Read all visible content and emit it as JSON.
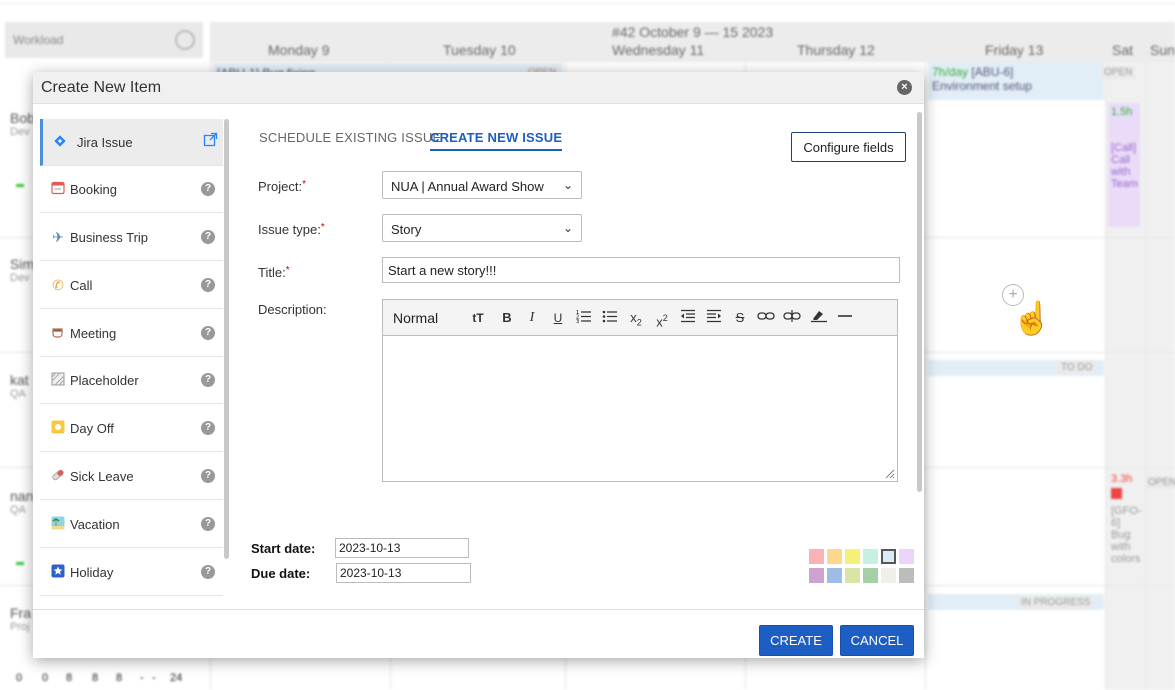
{
  "background": {
    "week_label": "#42 October 9 — 15 2023",
    "workload_label": "Workload",
    "days": [
      "Monday 9",
      "Tuesday 10",
      "Wednesday 11",
      "Thursday 12",
      "Friday 13",
      "Sat",
      "Sun"
    ],
    "users": [
      {
        "name": "Bob",
        "role": "Dev"
      },
      {
        "name": "Sim",
        "role": "Dev"
      },
      {
        "name": "kat",
        "role": "QA"
      },
      {
        "name": "nan",
        "role": "QA"
      },
      {
        "name": "Fra",
        "role": "Proj"
      }
    ],
    "events": {
      "monday_top": "[ABU-1] Bug fixing",
      "open_1": "OPEN",
      "friday_rate": "7h/day",
      "friday_issue": "[ABU-6]",
      "friday_title": "Environment setup",
      "open_2": "OPEN",
      "sat_purple_rate": "1.5h",
      "sat_purple_title": "[Call] Call with Team",
      "todo": "TO DO",
      "sat_red_rate": "3.3h",
      "sat_red_title": "[GFO-6] Bug with colors",
      "in_progress": "IN PROGRESS"
    },
    "bottom_values": [
      "0",
      "0",
      "8",
      "8",
      "8",
      "-",
      "-",
      "24"
    ]
  },
  "dialog": {
    "title": "Create New Item",
    "sidebar": [
      {
        "label": "Jira Issue",
        "icon": "jira-diamond-icon",
        "active": true
      },
      {
        "label": "Booking",
        "icon": "calendar-icon"
      },
      {
        "label": "Business Trip",
        "icon": "airplane-icon"
      },
      {
        "label": "Call",
        "icon": "phone-icon"
      },
      {
        "label": "Meeting",
        "icon": "coffee-icon"
      },
      {
        "label": "Placeholder",
        "icon": "placeholder-icon"
      },
      {
        "label": "Day Off",
        "icon": "sun-icon"
      },
      {
        "label": "Sick Leave",
        "icon": "pill-icon"
      },
      {
        "label": "Vacation",
        "icon": "beach-icon"
      },
      {
        "label": "Holiday",
        "icon": "star-icon"
      }
    ],
    "tabs": {
      "existing": "SCHEDULE EXISTING ISSUE",
      "new": "CREATE NEW ISSUE"
    },
    "configure_label": "Configure fields",
    "form": {
      "project_label": "Project:",
      "project_value": "NUA | Annual Award Show",
      "issue_type_label": "Issue type:",
      "issue_type_value": "Story",
      "title_label": "Title:",
      "title_value": "Start a new story!!!",
      "description_label": "Description:",
      "format_value": "Normal",
      "required_mark": "*"
    },
    "dates": {
      "start_label": "Start date:",
      "start_value": "2023-10-13",
      "due_label": "Due date:",
      "due_value": "2023-10-13"
    },
    "colors": {
      "row1": [
        "#f9b3b7",
        "#fbd88d",
        "#f5f178",
        "#c5f0e2",
        "#d8ebf7",
        "#ecd4fb"
      ],
      "row2": [
        "#cfa3cf",
        "#9ebde6",
        "#d9e5a4",
        "#a5cfa5",
        "#f1efe9",
        "#bcbcbc"
      ]
    },
    "buttons": {
      "create": "CREATE",
      "cancel": "CANCEL"
    }
  }
}
